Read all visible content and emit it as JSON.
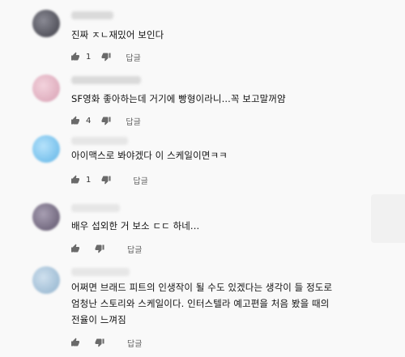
{
  "comments": [
    {
      "text": "진짜 ㅈㄴ재밌어 보인다",
      "like_count": "1",
      "reply_label": "답글",
      "avatar_color": "#5a5a66"
    },
    {
      "text": "SF영화 좋아하는데 거기에 빵형이라니...꼭 보고말꺼얌",
      "like_count": "4",
      "reply_label": "답글",
      "avatar_color": "#e7b9c8"
    },
    {
      "text": "아이맥스로 봐야겠다 이 스케일이면ㅋㅋ",
      "like_count": "1",
      "reply_label": "답글",
      "avatar_color": "#7cc4ee"
    },
    {
      "text": "배우 섭외한 거 보소 ㄷㄷ 하네...",
      "like_count": "",
      "reply_label": "답글",
      "avatar_color": "#7a6f85"
    },
    {
      "text": "어쩌면 브래드 피트의 인생작이 될 수도 있겠다는 생각이 들 정도로\n엄청난 스토리와 스케일이다. 인터스텔라 예고편을 처음 봤을 때의\n전율이 느껴짐",
      "like_count": "",
      "reply_label": "답글",
      "avatar_color": "#9fbcd3"
    }
  ],
  "icons": {
    "like": "thumbs-up-icon",
    "dislike": "thumbs-down-icon"
  }
}
